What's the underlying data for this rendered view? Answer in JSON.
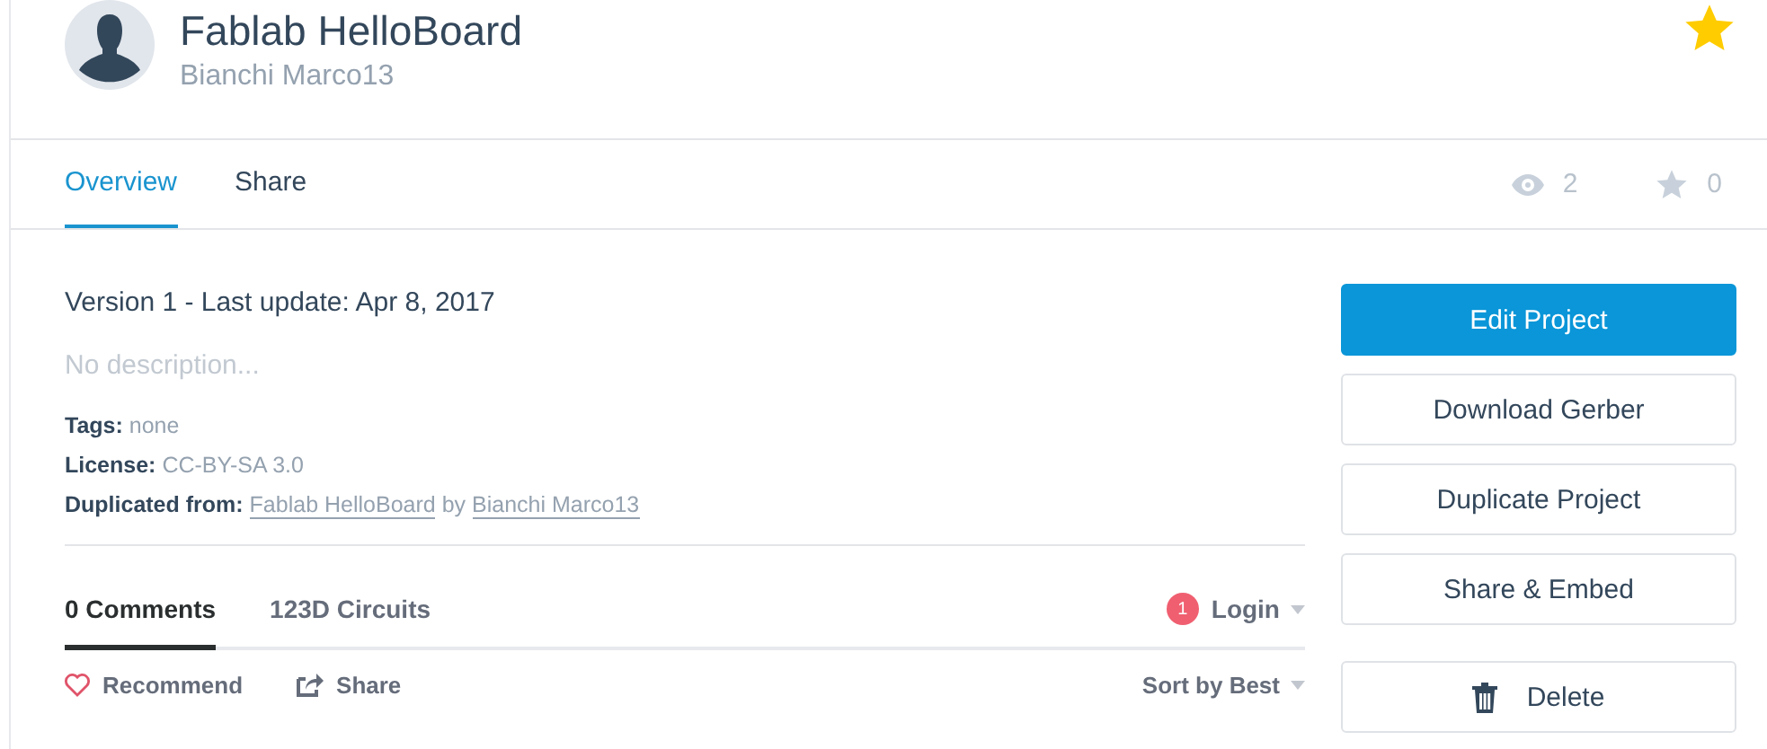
{
  "header": {
    "title": "Fablab HelloBoard",
    "author": "Bianchi Marco13",
    "favorite": true
  },
  "tabs": [
    {
      "label": "Overview",
      "selected": true
    },
    {
      "label": "Share",
      "selected": false
    }
  ],
  "stats": {
    "views": "2",
    "stars": "0"
  },
  "version": "Version 1 - Last update: Apr 8, 2017",
  "description": "No description...",
  "meta": [
    {
      "label": "Tags:",
      "value": "none",
      "kind": "text"
    },
    {
      "label": "License:",
      "value": "CC-BY-SA 3.0",
      "kind": "text"
    },
    {
      "label": "Duplicated from:",
      "kind": "links",
      "links": [
        "Fablab HelloBoard",
        "Bianchi Marco13"
      ],
      "joiner": "by"
    }
  ],
  "actions": [
    {
      "label": "Edit Project",
      "kind": "primary"
    },
    {
      "label": "Download Gerber",
      "kind": "plain"
    },
    {
      "label": "Duplicate Project",
      "kind": "plain"
    },
    {
      "label": "Share & Embed",
      "kind": "plain"
    },
    {
      "label": "Delete",
      "kind": "delete"
    }
  ],
  "comments": {
    "tabs": [
      {
        "label": "0 Comments",
        "selected": true
      },
      {
        "label": "123D Circuits",
        "selected": false
      }
    ],
    "notifications": "1",
    "login": "Login",
    "recommend": "Recommend",
    "share": "Share",
    "sort": "Sort by Best"
  }
}
